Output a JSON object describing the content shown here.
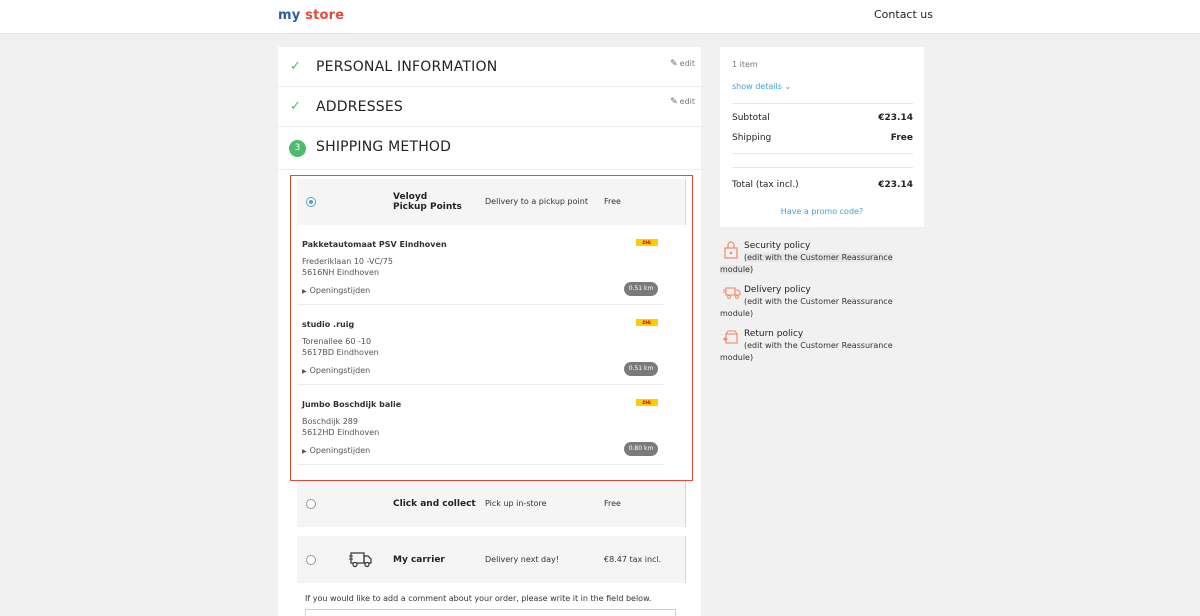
{
  "header": {
    "logo_part1": "my",
    "logo_part2": "store",
    "contact_label": "Contact us"
  },
  "steps": {
    "personal": {
      "title": "PERSONAL INFORMATION",
      "edit_label": "edit"
    },
    "addresses": {
      "title": "ADDRESSES",
      "edit_label": "edit"
    },
    "shipping": {
      "number": "3",
      "title": "SHIPPING METHOD"
    }
  },
  "carriers": [
    {
      "name": "Veloyd Pickup Points",
      "delay": "Delivery to a pickup point",
      "price": "Free",
      "selected": true
    },
    {
      "name": "Click and collect",
      "delay": "Pick up in-store",
      "price": "Free",
      "selected": false
    },
    {
      "name": "My carrier",
      "delay": "Delivery next day!",
      "price": "€8.47 tax incl.",
      "selected": false,
      "icon": "truck-icon"
    }
  ],
  "pickup_points": [
    {
      "name": "Pakketautomaat PSV Eindhoven",
      "address1": "Frederiklaan 10 -VC/75",
      "address2": "5616NH Eindhoven",
      "hours_label": "Openingstijden",
      "distance": "0.51 km",
      "logo": "DHL"
    },
    {
      "name": "studio .ruig",
      "address1": "Torenallee 60 -10",
      "address2": "5617BD Eindhoven",
      "hours_label": "Openingstijden",
      "distance": "0.51 km",
      "logo": "DHL"
    },
    {
      "name": "Jumbo Boschdijk balie",
      "address1": "Boschdijk 289",
      "address2": "5612HD Eindhoven",
      "hours_label": "Openingstijden",
      "distance": "0.80 km",
      "logo": "DHL"
    }
  ],
  "comment": {
    "label": "If you would like to add a comment about your order, please write it in the field below."
  },
  "summary": {
    "items": "1 item",
    "show_details": "show details",
    "subtotal_label": "Subtotal",
    "subtotal_value": "€23.14",
    "shipping_label": "Shipping",
    "shipping_value": "Free",
    "total_label": "Total (tax incl.)",
    "total_value": "€23.14",
    "promo_label": "Have a promo code?"
  },
  "reassurance": [
    {
      "title": "Security policy",
      "desc": "(edit with the Customer Reassurance module)",
      "icon": "lock-icon"
    },
    {
      "title": "Delivery policy",
      "desc": "(edit with the Customer Reassurance module)",
      "icon": "delivery-truck-icon"
    },
    {
      "title": "Return policy",
      "desc": "(edit with the Customer Reassurance module)",
      "icon": "return-box-icon"
    }
  ],
  "colors": {
    "accent": "#42a0d6",
    "success": "#4cbb6c",
    "highlight": "#e14c38"
  }
}
